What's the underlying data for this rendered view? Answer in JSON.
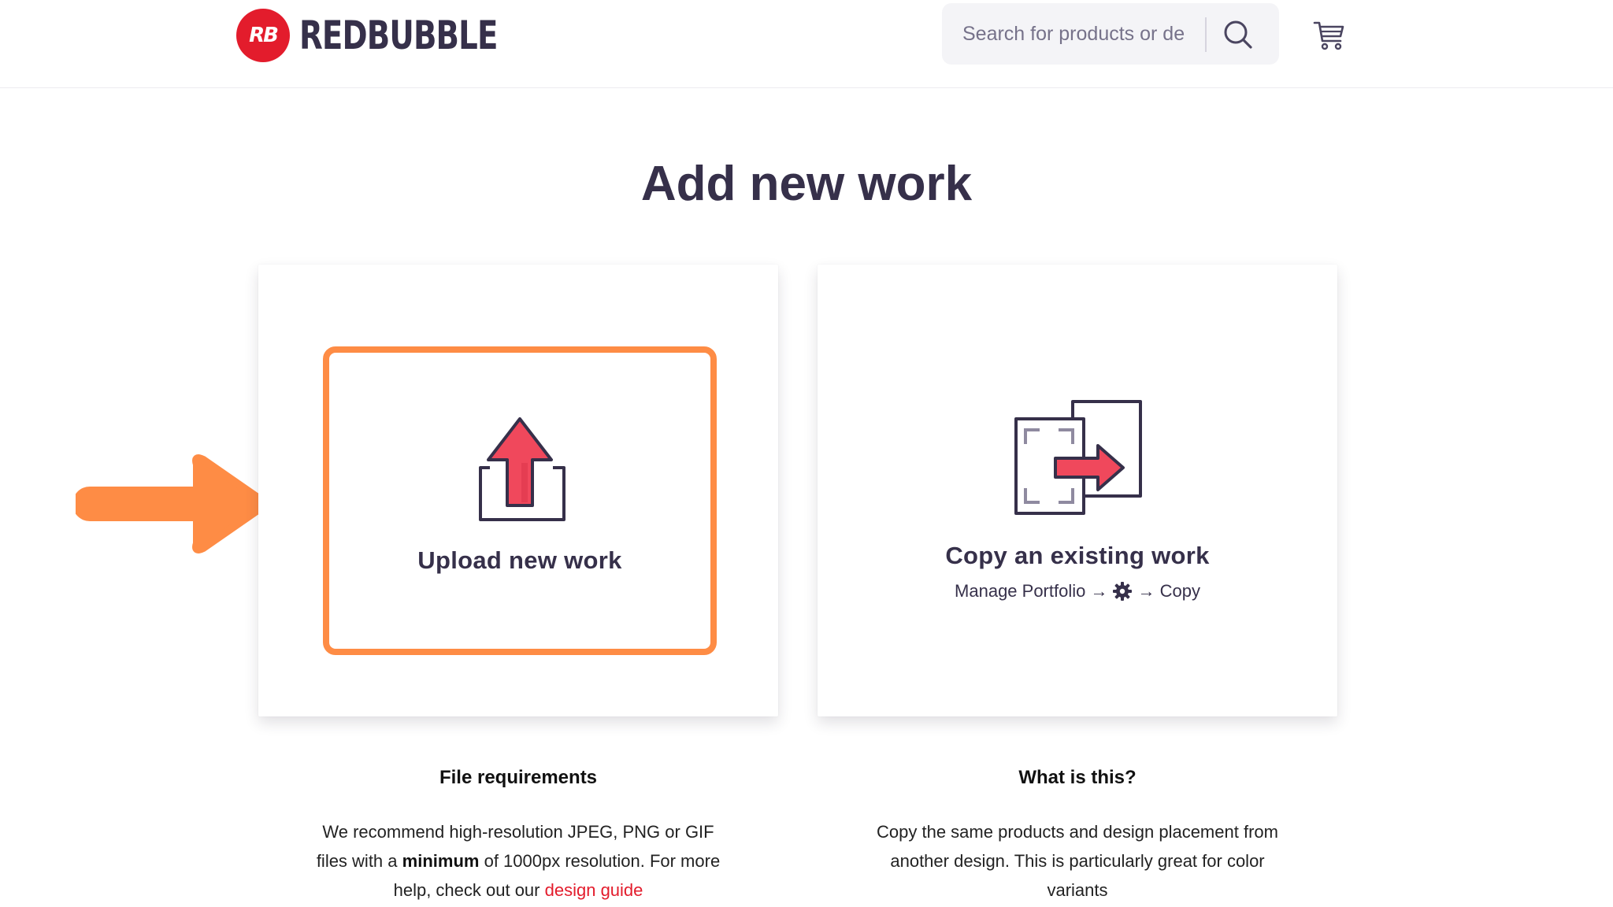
{
  "header": {
    "logo_text": "REDBUBBLE",
    "logo_mark": "RB",
    "search_placeholder": "Search for products or de",
    "search_icon": "search-icon",
    "cart_icon": "cart-icon"
  },
  "page_title": "Add new work",
  "cards": {
    "upload": {
      "label": "Upload new work",
      "icon": "upload-icon"
    },
    "copy": {
      "label": "Copy an existing work",
      "path_start": "Manage Portfolio →",
      "path_icon": "gear-icon",
      "path_end": "→ Copy",
      "icon": "copy-icon"
    }
  },
  "info": {
    "file_requirements": {
      "heading": "File requirements",
      "text_before": "We recommend high-resolution JPEG, PNG or GIF files with a",
      "text_bold": "minimum",
      "text_after": "of 1000px resolution. For more help, check out our",
      "link": "design guide"
    },
    "what_is_this": {
      "heading": "What is this?",
      "text": "Copy the same products and design placement from another design. This is particularly great for color variants"
    }
  },
  "colors": {
    "brand_red": "#e31c2c",
    "accent_orange": "#fe8c45",
    "text_dark": "#36304a",
    "icon_pink": "#f0485c"
  }
}
